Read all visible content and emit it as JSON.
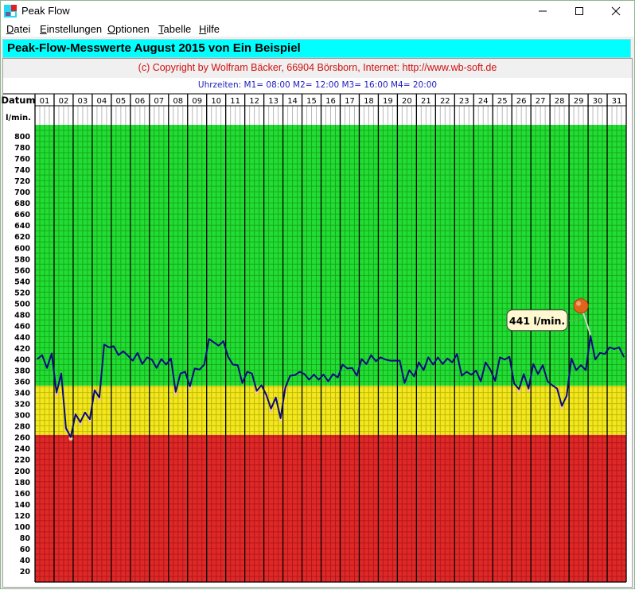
{
  "window": {
    "title": "Peak Flow",
    "minimize_icon": "minimize-icon",
    "maximize_icon": "maximize-icon",
    "close_icon": "close-icon"
  },
  "menu": [
    {
      "label": "Datei",
      "accel": "D"
    },
    {
      "label": "Einstellungen",
      "accel": "E"
    },
    {
      "label": "Optionen",
      "accel": "O"
    },
    {
      "label": "Tabelle",
      "accel": "T"
    },
    {
      "label": "Hilfe",
      "accel": "H"
    }
  ],
  "headline": "Peak-Flow-Messwerte August 2015 von  Ein Beispiel",
  "copyright": "(c) Copyright by  Wolfram Bäcker, 66904 Börsborn, Internet: http://www.wb-soft.de",
  "times_line": "Uhrzeiten: M1= 08:00  M2= 12:00  M3= 16:00  M4= 20:00",
  "colors": {
    "green_zone": "#22dd33",
    "yellow_zone": "#f0e820",
    "red_zone": "#e02828",
    "line": "#0a0a80",
    "headline_bg": "#00ffff",
    "copyright_text": "#d01010",
    "times_text": "#2020c0"
  },
  "chart_data": {
    "type": "line",
    "title": "Peak-Flow-Messwerte August 2015",
    "xlabel": "Datum",
    "ylabel": "l/min.",
    "ylim": [
      0,
      820
    ],
    "yticks": [
      20,
      40,
      60,
      80,
      100,
      120,
      140,
      160,
      180,
      200,
      220,
      240,
      260,
      280,
      300,
      320,
      340,
      360,
      380,
      400,
      420,
      440,
      460,
      480,
      500,
      520,
      540,
      560,
      580,
      600,
      620,
      640,
      660,
      680,
      700,
      720,
      740,
      760,
      780,
      800
    ],
    "grid": true,
    "categories": [
      "01",
      "02",
      "03",
      "04",
      "05",
      "06",
      "07",
      "08",
      "09",
      "10",
      "11",
      "12",
      "13",
      "14",
      "15",
      "16",
      "17",
      "18",
      "19",
      "20",
      "21",
      "22",
      "23",
      "24",
      "25",
      "26",
      "27",
      "28",
      "29",
      "30",
      "31"
    ],
    "measurements_per_day": [
      "M1",
      "M2",
      "M3",
      "M4"
    ],
    "zones": [
      {
        "name": "green",
        "from": 352,
        "to": 820
      },
      {
        "name": "yellow",
        "from": 264,
        "to": 352
      },
      {
        "name": "red",
        "from": 0,
        "to": 264
      }
    ],
    "series": [
      {
        "name": "Peak Flow (l/min.)",
        "values": [
          [
            400,
            407,
            384,
            410
          ],
          [
            340,
            374,
            276,
            260
          ],
          [
            301,
            287,
            304,
            292
          ],
          [
            344,
            331,
            426,
            421
          ],
          [
            423,
            407,
            414,
            406
          ],
          [
            397,
            411,
            391,
            403
          ],
          [
            399,
            384,
            400,
            390
          ],
          [
            401,
            341,
            374,
            377
          ],
          [
            351,
            383,
            381,
            390
          ],
          [
            436,
            430,
            424,
            432
          ],
          [
            404,
            390,
            389,
            357
          ],
          [
            377,
            374,
            343,
            353
          ],
          [
            336,
            311,
            331,
            294
          ],
          [
            349,
            370,
            371,
            377
          ],
          [
            373,
            363,
            372,
            363
          ],
          [
            372,
            360,
            373,
            367
          ],
          [
            390,
            383,
            384,
            370
          ],
          [
            400,
            391,
            407,
            396
          ],
          [
            403,
            399,
            397,
            397
          ],
          [
            397,
            357,
            380,
            369
          ],
          [
            394,
            380,
            403,
            390
          ],
          [
            403,
            391,
            401,
            394
          ],
          [
            409,
            370,
            377,
            372
          ],
          [
            379,
            360,
            394,
            381
          ],
          [
            361,
            403,
            399,
            404
          ],
          [
            356,
            346,
            373,
            347
          ],
          [
            391,
            373,
            389,
            360
          ],
          [
            353,
            347,
            316,
            334
          ],
          [
            401,
            380,
            389,
            380
          ],
          [
            441,
            399,
            411,
            409
          ],
          [
            421,
            418,
            421,
            404
          ]
        ]
      }
    ],
    "annotations": [
      {
        "label": "441 l/min.",
        "day": "30",
        "measurement": "M1",
        "value": 441,
        "marker": "pin-icon"
      }
    ]
  }
}
